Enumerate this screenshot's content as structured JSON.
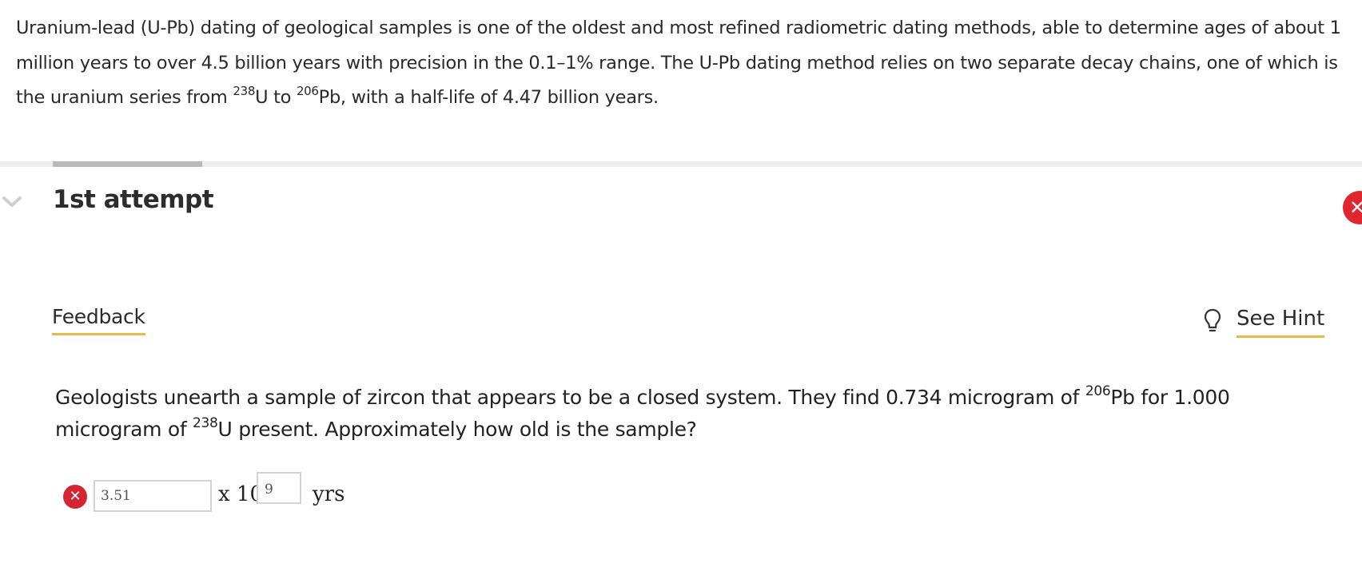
{
  "intro": {
    "text_1": "Uranium-lead (U-Pb) dating of geological samples is one of the oldest and most refined radiometric dating methods, able to determine ages of about 1 million years to over 4.5 billion years with precision in the 0.1–1% range. The U-Pb dating method relies on two separate decay chains, one of which is the uranium series from ",
    "sup_1": "238",
    "text_2": "U to ",
    "sup_2": "206",
    "text_3": "Pb, with a half-life of 4.47 billion years."
  },
  "attempt": {
    "title": "1st attempt",
    "status_icon": "close-icon",
    "status_color": "#e0262f",
    "progress_fraction": 0.11
  },
  "tabs": {
    "feedback_label": "Feedback",
    "hint_label": "See Hint",
    "hint_icon": "lightbulb-icon",
    "underline_color": "#e8b84b"
  },
  "question": {
    "text_1": "Geologists unearth a sample of zircon that appears to be a closed system. They find 0.734 microgram of ",
    "sup_1": "206",
    "text_2": "Pb for 1.000 microgram of ",
    "sup_2": "238",
    "text_3": "U present. Approximately how old is the sample?"
  },
  "answer": {
    "status": "incorrect",
    "status_icon": "close-icon",
    "value": "3.51",
    "multiplier_label": "x 10",
    "exponent_value": "9",
    "unit": "yrs"
  }
}
